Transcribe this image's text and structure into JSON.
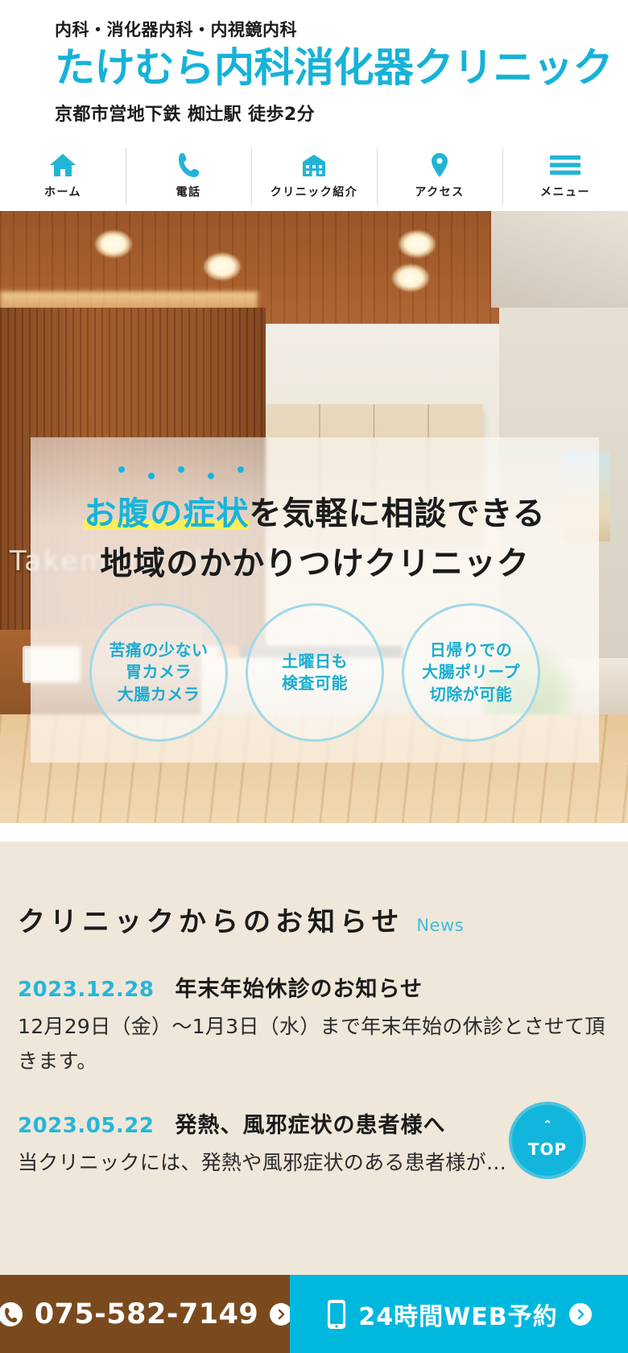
{
  "brand": {
    "accent": "#16B2D8",
    "subtitle": "内科・消化器内科・内視鏡内科",
    "title": "たけむら内科消化器クリニック",
    "access": "京都市営地下鉄 椥辻駅 徒歩2分"
  },
  "nav": {
    "items": [
      {
        "label": "ホーム",
        "icon": "home-icon"
      },
      {
        "label": "電話",
        "icon": "phone-icon"
      },
      {
        "label": "クリニック紹介",
        "icon": "hospital-icon"
      },
      {
        "label": "アクセス",
        "icon": "map-pin-icon"
      },
      {
        "label": "メニュー",
        "icon": "hamburger-icon"
      }
    ]
  },
  "hero": {
    "photo_sign": "Takemura Clinic",
    "line1_highlight": "お腹の症状",
    "line1_rest": "を気軽に相談できる",
    "line2": "地域のかかりつけクリニック",
    "circles": [
      {
        "lines": [
          "苦痛の少ない",
          "胃カメラ",
          "大腸カメラ"
        ]
      },
      {
        "lines": [
          "土曜日も",
          "検査可能"
        ]
      },
      {
        "lines": [
          "日帰りでの",
          "大腸ポリープ",
          "切除が可能"
        ]
      }
    ]
  },
  "news": {
    "heading_ja": "クリニックからのお知らせ",
    "heading_en": "News",
    "items": [
      {
        "date": "2023.12.28",
        "title": "年末年始休診のお知らせ",
        "body": "12月29日（金）〜1月3日（水）まで年末年始の休診とさせて頂きます。"
      },
      {
        "date": "2023.05.22",
        "title": "発熱、風邪症状の患者様へ",
        "body": "当クリニックには、発熱や風邪症状のある患者様が…"
      }
    ]
  },
  "top_button": {
    "caret": "＾",
    "label": "TOP"
  },
  "bottom_bar": {
    "tel": "075-582-7149",
    "tel_bg": "#7A4A1E",
    "web": "24時間WEB予約",
    "web_bg": "#00B8DE"
  }
}
